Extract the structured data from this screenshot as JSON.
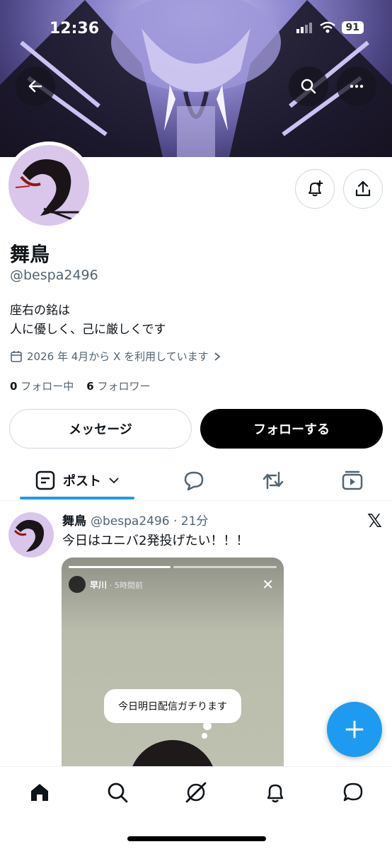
{
  "status_bar": {
    "time": "12:36",
    "battery": "91"
  },
  "profile": {
    "name": "舞鳥",
    "handle": "@bespa2496",
    "bio_line1": "座右の銘は",
    "bio_line2": "人に優しく、己に厳しくです",
    "joined": "2026 年 4月から X を利用しています",
    "following_count": "0",
    "following_label": "フォロー中",
    "followers_count": "6",
    "followers_label": "フォロワー"
  },
  "actions": {
    "message": "メッセージ",
    "follow": "フォローする"
  },
  "tabs": {
    "posts_label": "ポスト"
  },
  "post": {
    "name": "舞鳥",
    "meta": "@bespa2496 · 21分",
    "text": "今日はユニバ2発投げたい！！！",
    "story_user": "早川",
    "story_time": "· 5時間前",
    "bubble": "今日明日配信ガチります"
  },
  "colors": {
    "accent": "#1d9bf0",
    "follow_bg": "#000000",
    "secondary_text": "#536471"
  },
  "icons": [
    "back-arrow-icon",
    "search-icon",
    "more-icon",
    "notification-add-icon",
    "share-icon",
    "calendar-icon",
    "chevron-right-icon",
    "post-list-icon",
    "chevron-down-icon",
    "reply-icon",
    "repost-icon",
    "media-icon",
    "x-logo-icon",
    "close-icon",
    "plus-icon",
    "home-icon",
    "grok-icon",
    "bell-icon",
    "messages-icon"
  ]
}
